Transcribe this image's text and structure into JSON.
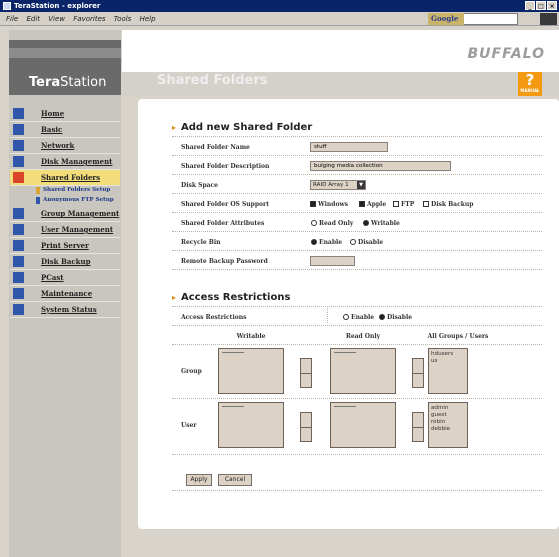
{
  "window": {
    "title": "TeraStation - explorer"
  },
  "menubar": {
    "items": [
      "File",
      "Edit",
      "View",
      "Favorites",
      "Tools",
      "Help"
    ]
  },
  "google": {
    "label": "Google"
  },
  "brand": {
    "logo_tera": "Tera",
    "logo_station": "Station",
    "vendor": "BUFFALO",
    "manual": "MANUAL"
  },
  "page": {
    "title": "Shared Folders"
  },
  "nav": {
    "items": [
      {
        "label": "Home"
      },
      {
        "label": "Basic"
      },
      {
        "label": "Network"
      },
      {
        "label": "Disk Management"
      },
      {
        "label": "Shared Folders"
      },
      {
        "label": "Group Management"
      },
      {
        "label": "User Management"
      },
      {
        "label": "Print Server"
      },
      {
        "label": "Disk Backup"
      },
      {
        "label": "PCast"
      },
      {
        "label": "Maintenance"
      },
      {
        "label": "System Status"
      }
    ],
    "sub": [
      "Shared Folders Setup",
      "Anonymous FTP Setup"
    ]
  },
  "form": {
    "section_title": "Add new Shared Folder",
    "name_label": "Shared Folder Name",
    "name_value": "stuff",
    "desc_label": "Shared Folder Description",
    "desc_value": "bulging media collection",
    "disk_label": "Disk Space",
    "disk_value": "RAID Array 1",
    "os_label": "Shared Folder OS Support",
    "os_options": [
      "Windows",
      "Apple",
      "FTP",
      "Disk Backup"
    ],
    "attr_label": "Shared Folder Attributes",
    "attr_options": [
      "Read Only",
      "Writable"
    ],
    "recycle_label": "Recycle Bin",
    "recycle_options": [
      "Enable",
      "Disable"
    ],
    "backup_pw_label": "Remote Backup Password"
  },
  "access": {
    "section_title": "Access Restrictions",
    "label": "Access Restrictions",
    "options": [
      "Enable",
      "Disable"
    ],
    "col_writable": "Writable",
    "col_readonly": "Read Only",
    "col_all": "All Groups / Users",
    "group_label": "Group",
    "user_label": "User",
    "groups": [
      "hdusers",
      "us"
    ],
    "users": [
      "admin",
      "guest",
      "robin",
      "debbie"
    ]
  },
  "buttons": {
    "apply": "Apply",
    "cancel": "Cancel"
  }
}
